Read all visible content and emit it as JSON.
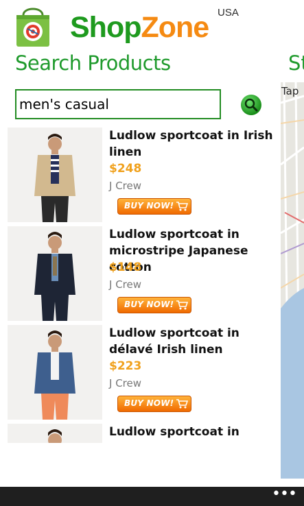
{
  "header": {
    "brand_part1": "Shop",
    "brand_part2": "Zone",
    "region": "USA",
    "brand_colors": {
      "shop": "#1e9a1e",
      "zone": "#f58a12"
    },
    "logo_icon": "shopping-bag-target-icon"
  },
  "page": {
    "title": "Search Products",
    "next_pivot_title": "St",
    "accent_color": "#1f9a2c"
  },
  "search": {
    "query": "men's casual",
    "button_icon": "search-icon"
  },
  "map": {
    "hint_text": "Tap"
  },
  "products": [
    {
      "name": "Ludlow sportcoat in Irish linen",
      "price": "$248",
      "brand": "J Crew",
      "buy_label": "BUY NOW!",
      "jacket_color": "#d2b98f",
      "pants_color": "#2a2a2a"
    },
    {
      "name": "Ludlow sportcoat in microstripe Japanese cotton",
      "price": "$148",
      "brand": "J Crew",
      "buy_label": "BUY NOW!",
      "jacket_color": "#1e2535",
      "pants_color": "#1e2535"
    },
    {
      "name": "Ludlow sportcoat in délavé Irish linen",
      "price": "$223",
      "brand": "J Crew",
      "buy_label": "BUY NOW!",
      "jacket_color": "#3e5f8e",
      "pants_color": "#ef8a5a"
    },
    {
      "name": "Ludlow sportcoat in indigo",
      "price": "",
      "brand": "",
      "buy_label": "",
      "jacket_color": "#2b3a5c",
      "pants_color": "#2b3a5c"
    }
  ],
  "app_bar": {
    "more_icon": "ellipsis-icon",
    "more_label": "•••"
  },
  "colors": {
    "price": "#f0a11d",
    "buy_button": "#f58200",
    "app_bar": "#1f1f1f"
  }
}
